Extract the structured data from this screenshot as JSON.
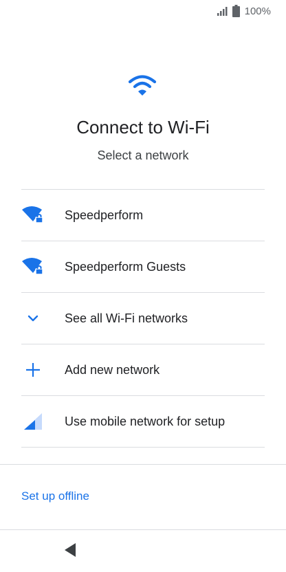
{
  "status_bar": {
    "battery_percent": "100%",
    "signal_icon": "signal-icon",
    "battery_icon": "battery-icon"
  },
  "header": {
    "icon": "wifi-icon",
    "title": "Connect to Wi-Fi",
    "subtitle": "Select a network"
  },
  "networks": {
    "items": [
      {
        "label": "Speedperform",
        "icon": "wifi-lock-icon"
      },
      {
        "label": "Speedperform Guests",
        "icon": "wifi-lock-icon"
      },
      {
        "label": "See all Wi-Fi networks",
        "icon": "chevron-down-icon"
      },
      {
        "label": "Add new network",
        "icon": "plus-icon"
      },
      {
        "label": "Use mobile network for setup",
        "icon": "cell-signal-icon"
      }
    ]
  },
  "footer": {
    "offline_label": "Set up offline"
  },
  "nav": {
    "back_icon": "back-icon"
  },
  "colors": {
    "accent": "#1a73e8",
    "divider": "#dadce0",
    "text_primary": "#202124"
  }
}
